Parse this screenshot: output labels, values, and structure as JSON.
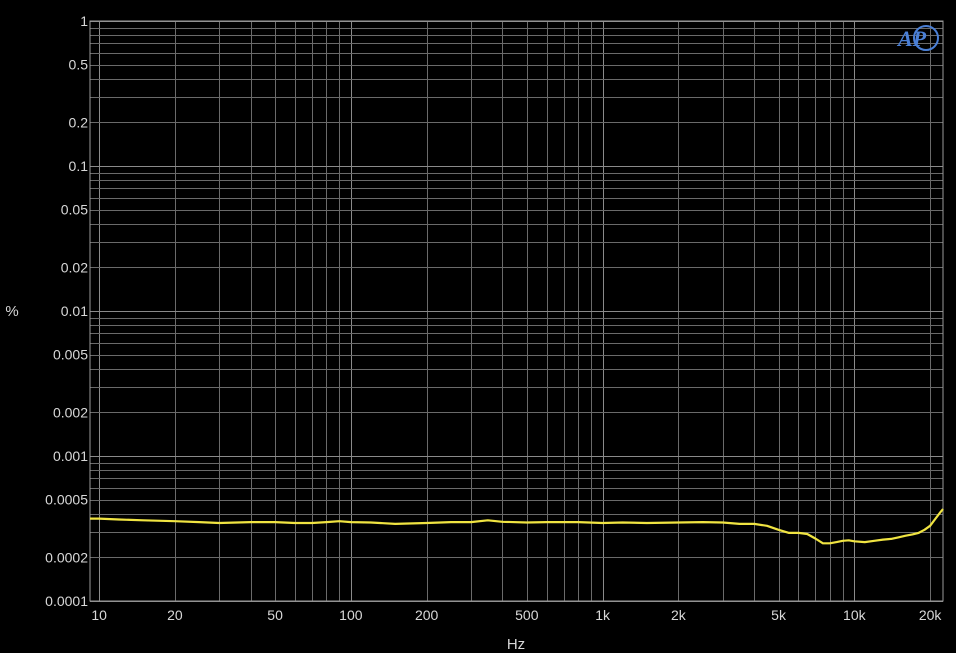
{
  "chart_data": {
    "type": "line",
    "title": "",
    "xlabel": "Hz",
    "ylabel": "%",
    "x_scale": "log",
    "y_scale": "log",
    "xlim": [
      9.2,
      22500
    ],
    "ylim": [
      0.0001,
      1
    ],
    "grid": true,
    "x_ticks": [
      {
        "value": 10,
        "label": "10"
      },
      {
        "value": 20,
        "label": "20"
      },
      {
        "value": 50,
        "label": "50"
      },
      {
        "value": 100,
        "label": "100"
      },
      {
        "value": 200,
        "label": "200"
      },
      {
        "value": 500,
        "label": "500"
      },
      {
        "value": 1000,
        "label": "1k"
      },
      {
        "value": 2000,
        "label": "2k"
      },
      {
        "value": 5000,
        "label": "5k"
      },
      {
        "value": 10000,
        "label": "10k"
      },
      {
        "value": 20000,
        "label": "20k"
      }
    ],
    "y_ticks": [
      {
        "value": 1,
        "label": "1"
      },
      {
        "value": 0.5,
        "label": "0.5"
      },
      {
        "value": 0.2,
        "label": "0.2"
      },
      {
        "value": 0.1,
        "label": "0.1"
      },
      {
        "value": 0.05,
        "label": "0.05"
      },
      {
        "value": 0.02,
        "label": "0.02"
      },
      {
        "value": 0.01,
        "label": "0.01"
      },
      {
        "value": 0.005,
        "label": "0.005"
      },
      {
        "value": 0.002,
        "label": "0.002"
      },
      {
        "value": 0.001,
        "label": "0.001"
      },
      {
        "value": 0.0005,
        "label": "0.0005"
      },
      {
        "value": 0.0002,
        "label": "0.0002"
      },
      {
        "value": 0.0001,
        "label": "0.0001"
      }
    ],
    "series": [
      {
        "color": "#f0e442",
        "x": [
          9.2,
          10,
          12,
          15,
          20,
          25,
          30,
          40,
          50,
          60,
          70,
          80,
          90,
          100,
          120,
          150,
          200,
          250,
          300,
          350,
          400,
          500,
          600,
          800,
          1000,
          1200,
          1500,
          2000,
          2500,
          3000,
          3500,
          4000,
          4500,
          5000,
          5500,
          6000,
          6500,
          7000,
          7500,
          8000,
          8500,
          9000,
          9500,
          10000,
          11000,
          12000,
          13000,
          14000,
          15000,
          16000,
          17000,
          18000,
          19000,
          20000,
          21000,
          22000,
          22500
        ],
        "values": [
          0.00037,
          0.00037,
          0.000365,
          0.00036,
          0.000355,
          0.00035,
          0.000345,
          0.00035,
          0.00035,
          0.000345,
          0.000345,
          0.00035,
          0.000355,
          0.00035,
          0.000348,
          0.00034,
          0.000345,
          0.00035,
          0.00035,
          0.00036,
          0.000352,
          0.000348,
          0.00035,
          0.00035,
          0.000345,
          0.000348,
          0.000345,
          0.000348,
          0.00035,
          0.000348,
          0.00034,
          0.00034,
          0.00033,
          0.00031,
          0.000295,
          0.000295,
          0.00029,
          0.00027,
          0.00025,
          0.00025,
          0.000255,
          0.00026,
          0.000262,
          0.000258,
          0.000255,
          0.00026,
          0.000265,
          0.000268,
          0.000275,
          0.000282,
          0.000288,
          0.000295,
          0.00031,
          0.00033,
          0.00037,
          0.00041,
          0.00043
        ]
      }
    ]
  },
  "logo": {
    "icon": "ap-logo-icon",
    "text": "AP",
    "color": "#4a7fd6"
  }
}
